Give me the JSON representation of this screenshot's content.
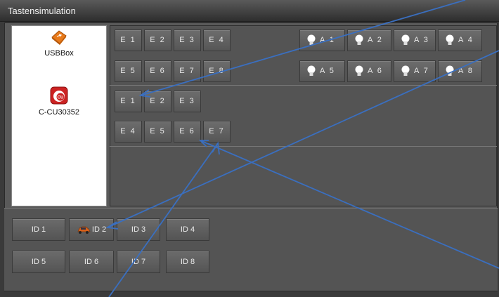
{
  "window": {
    "title": "Tastensimulation"
  },
  "devices": [
    {
      "name": "USBBox",
      "icon": "usb-box-icon"
    },
    {
      "name": "C-CU30352",
      "icon": "cu-logo-icon"
    }
  ],
  "usbbox_inputs": [
    "E 1",
    "E 2",
    "E 3",
    "E 4",
    "E 5",
    "E 6",
    "E 7",
    "E 8"
  ],
  "usbbox_outputs": [
    "A 1",
    "A 2",
    "A 3",
    "A 4",
    "A 5",
    "A 6",
    "A 7",
    "A 8"
  ],
  "ccu_inputs": [
    "E 1",
    "E 2",
    "E 3",
    "E 4",
    "E 5",
    "E 6",
    "E 7"
  ],
  "ids": [
    "ID 1",
    "ID 2",
    "ID 3",
    "ID 4",
    "ID 5",
    "ID 6",
    "ID 7",
    "ID 8"
  ],
  "colors": {
    "annotation_arrow": "#3a6fc0",
    "cu_red": "#cc2222",
    "usb_orange": "#e87a1a"
  }
}
